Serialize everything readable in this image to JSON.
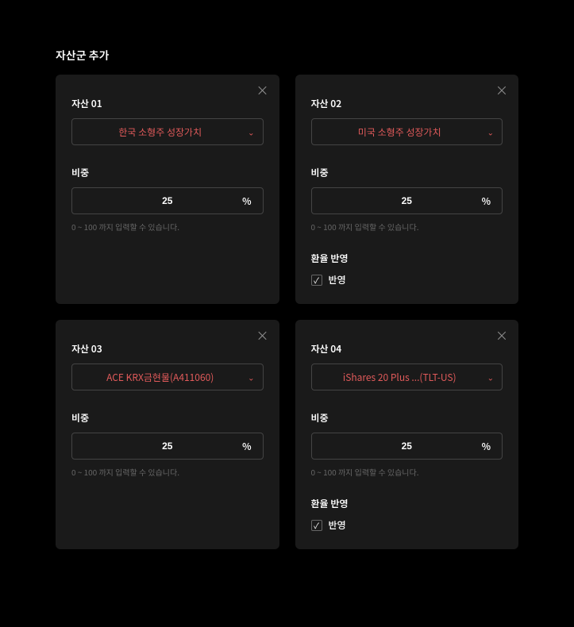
{
  "section_title": "자산군 추가",
  "labels": {
    "weight": "비중",
    "weight_helper": "0 ~ 100 까지 입력할 수 있습니다.",
    "fx": "환율 반영",
    "fx_checkbox": "반영",
    "weight_unit": "%"
  },
  "assets": [
    {
      "title": "자산 01",
      "selected": "한국 소형주 성장가치",
      "weight": "25",
      "show_fx": false,
      "fx_checked": false
    },
    {
      "title": "자산 02",
      "selected": "미국 소형주 성장가치",
      "weight": "25",
      "show_fx": true,
      "fx_checked": true
    },
    {
      "title": "자산 03",
      "selected": "ACE KRX금현물(A411060)",
      "weight": "25",
      "show_fx": false,
      "fx_checked": false
    },
    {
      "title": "자산 04",
      "selected": "iShares 20 Plus ...(TLT-US)",
      "weight": "25",
      "show_fx": true,
      "fx_checked": true
    }
  ]
}
